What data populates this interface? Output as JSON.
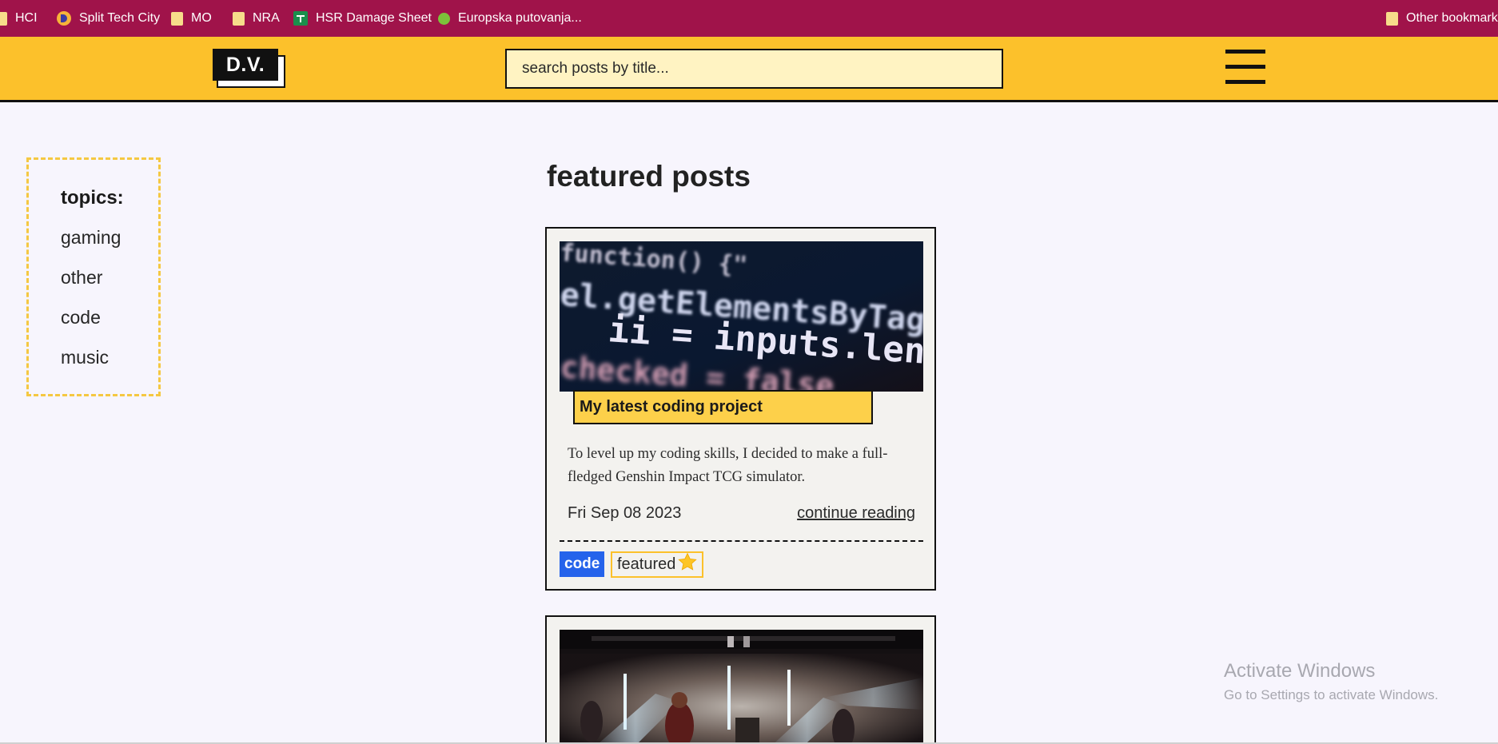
{
  "bookmarks": {
    "items": [
      {
        "label": "HCI",
        "icon": "folder-icon"
      },
      {
        "label": "Split Tech City",
        "icon": "split-tech-city-icon"
      },
      {
        "label": "MO",
        "icon": "folder-icon"
      },
      {
        "label": "NRA",
        "icon": "folder-icon"
      },
      {
        "label": "HSR Damage Sheet",
        "icon": "sheets-icon"
      },
      {
        "label": "Europska putovanja...",
        "icon": "green-dot-icon"
      }
    ],
    "other": "Other bookmarks",
    "bg_color": "#a0134a"
  },
  "header": {
    "logo": "D.V.",
    "search_placeholder": "search posts by title...",
    "menu_icon": "hamburger-icon",
    "bg_color": "#fcc12b"
  },
  "sidebar": {
    "title": "topics:",
    "topics": [
      "gaming",
      "other",
      "code",
      "music"
    ]
  },
  "main": {
    "section_title": "featured posts",
    "posts": [
      {
        "title": "My latest coding project",
        "image": "code-screen-image",
        "excerpt": "To level up my coding skills, I decided to make a full-fledged Genshin Impact TCG simulator.",
        "date": "Fri Sep 08 2023",
        "continue_label": "continue reading",
        "tags": [
          "code",
          "featured"
        ],
        "featured_icon": "star-icon"
      },
      {
        "image": "concert-stage-image"
      }
    ]
  },
  "watermark": {
    "title": "Activate Windows",
    "subtitle": "Go to Settings to activate Windows."
  }
}
